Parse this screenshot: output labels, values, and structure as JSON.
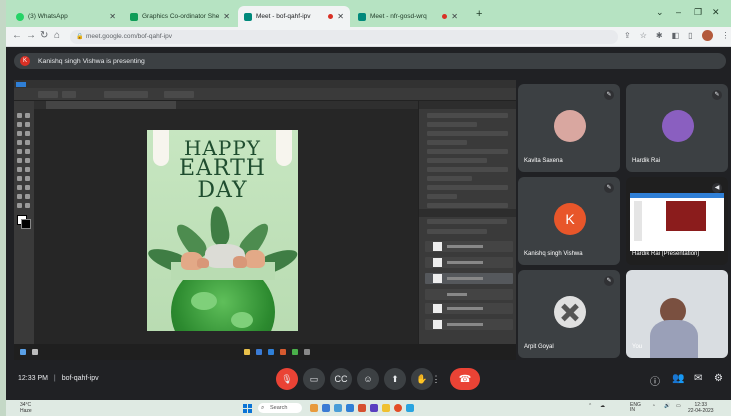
{
  "browser": {
    "tabs": [
      {
        "title": "(3) WhatsApp",
        "favicon_color": "#25d366",
        "active": false
      },
      {
        "title": "Graphics Co-ordinator Sheet - G...",
        "favicon_color": "#0f9d58",
        "active": false
      },
      {
        "title": "Meet - bof-qahf-ipv",
        "favicon_color": "#00897b",
        "active": true
      },
      {
        "title": "Meet - nfr-gosd-wrq",
        "favicon_color": "#00897b",
        "active": false
      }
    ],
    "new_tab": "+",
    "url": "meet.google.com/bof-qahf-ipv"
  },
  "meet": {
    "presenting_banner": "Kanishq singh Vishwa is presenting",
    "presenter_initial": "K",
    "participants": [
      {
        "name": "Kavita Saxena",
        "avatar_color": "#d9a7a0"
      },
      {
        "name": "Hardik Rai",
        "avatar_color": "#8a5fc0"
      },
      {
        "name": "Kanishq singh Vishwa",
        "avatar_initial": "K",
        "avatar_color": "#e8562a"
      },
      {
        "name": "Hardik Rai (Presentation)"
      },
      {
        "name": "Arpit Goyal",
        "avatar_color": "#e0e0e0"
      },
      {
        "name": "You"
      }
    ],
    "time": "12:33 PM",
    "meeting_code": "bof-qahf-ipv"
  },
  "poster": {
    "line1": "HAPPY",
    "line2": "EARTH",
    "line3": "DAY"
  },
  "taskbar": {
    "weather_temp": "34°C",
    "weather_desc": "Haze",
    "search": "Search",
    "lang": "ENG",
    "region": "IN",
    "clock_time": "12:33",
    "clock_date": "22-04-2023"
  },
  "colors": {
    "meet_bg": "#202124",
    "tile_bg": "#3c4043",
    "end_call": "#ea4335",
    "tab_strip": "#b6e3c2",
    "poster_green": "#1f4d2f"
  }
}
